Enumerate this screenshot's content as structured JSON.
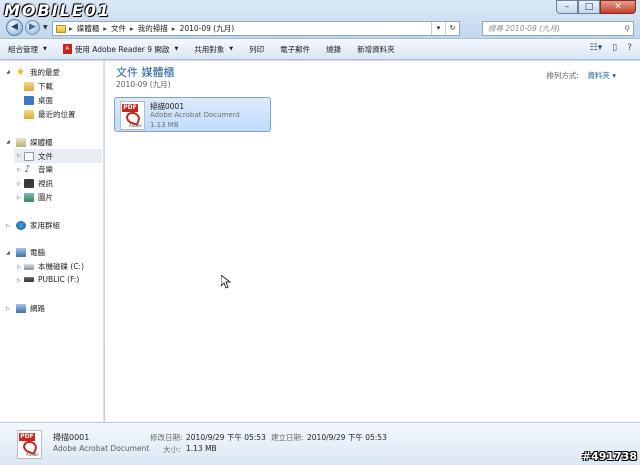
{
  "watermark": "MOBILE01",
  "window_controls": {
    "minimize": "–",
    "maximize": "□",
    "close": "✕"
  },
  "address": {
    "crumbs": [
      "媒體櫃",
      "文件",
      "我的掃描",
      "2010-09 (九月)"
    ],
    "separator": "▸",
    "dropdown": "▾",
    "refresh": "↻"
  },
  "search": {
    "placeholder": "搜尋 2010-09 (九月)"
  },
  "commands": {
    "organize": "組合管理",
    "open_with": "使用 Adobe Reader 9 開啟",
    "share": "共用對象",
    "print": "列印",
    "email": "電子郵件",
    "burn": "燒錄",
    "new_folder": "新增資料夾"
  },
  "sidebar": {
    "favorites": "我的最愛",
    "downloads": "下載",
    "desktop": "桌面",
    "recent": "最近的位置",
    "libraries": "媒體櫃",
    "documents": "文件",
    "music": "音樂",
    "videos": "視訊",
    "pictures": "圖片",
    "homegroup": "家用群組",
    "computer": "電腦",
    "drive_c": "本機磁碟 (C:)",
    "drive_f": "PUBLIC (F:)",
    "network": "網路"
  },
  "main": {
    "title": "文件 媒體櫃",
    "subtitle": "2010-09 (九月)",
    "arrange_label": "排列方式:",
    "arrange_value": "資料夾",
    "file": {
      "name": "掃描0001",
      "type": "Adobe Acrobat Document",
      "size": "1.13 MB",
      "icon_text": "PDF",
      "icon_sub": "Adobe"
    }
  },
  "details": {
    "name": "掃描0001",
    "type": "Adobe Acrobat Document",
    "modified_label": "修改日期:",
    "modified_value": "2010/9/29 下午 05:53",
    "created_label": "建立日期:",
    "created_value": "2010/9/29 下午 05:53",
    "size_label": "大小:",
    "size_value": "1.13 MB"
  },
  "post_id": "#491738",
  "colors": {
    "accent": "#1e5a9c",
    "selection": "#c1dbfc",
    "pdf_red": "#c8251d"
  }
}
